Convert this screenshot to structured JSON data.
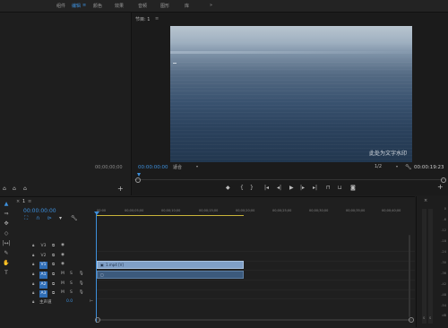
{
  "workspaces": [
    {
      "label": "组件",
      "active": false
    },
    {
      "label": "编辑",
      "active": true
    },
    {
      "label": "颜色",
      "active": false
    },
    {
      "label": "效果",
      "active": false
    },
    {
      "label": "音频",
      "active": false
    },
    {
      "label": "图形",
      "active": false
    },
    {
      "label": "库",
      "active": false
    }
  ],
  "source_panel": {
    "timecode": "00;00;00;00"
  },
  "program": {
    "tab_label": "节目: 1",
    "timecode_current": "00:00:00:00",
    "fit_label": "适合",
    "resolution_label": "1/2",
    "timecode_duration": "00:00:19:23",
    "watermark": "此处为文字水印"
  },
  "timeline": {
    "tab_label": "1",
    "timecode": "00:00:00:00",
    "ruler_ticks": [
      "00:00",
      "00;00;05;00",
      "00;00;10;00",
      "00;00;15;00",
      "00;00;20;00",
      "00;00;25;00",
      "00;00;30;00",
      "00;00;35;00",
      "00;00;40;00"
    ],
    "video_tracks": [
      "V3",
      "V2",
      "V1"
    ],
    "audio_tracks": [
      "A1",
      "A2",
      "A3"
    ],
    "master_label": "主声道",
    "master_value": "0.0",
    "clip_name": "1.mp4 [V]"
  },
  "meter": {
    "scale": [
      "0",
      "-6",
      "-12",
      "-18",
      "-24",
      "-30",
      "-36",
      "-42",
      "-48",
      "-54",
      "dB"
    ],
    "footer": [
      "S",
      "S"
    ]
  },
  "colors": {
    "accent": "#3d8fdb",
    "clip_video": "#7f9fc6",
    "clip_audio": "#3c5a7c"
  }
}
